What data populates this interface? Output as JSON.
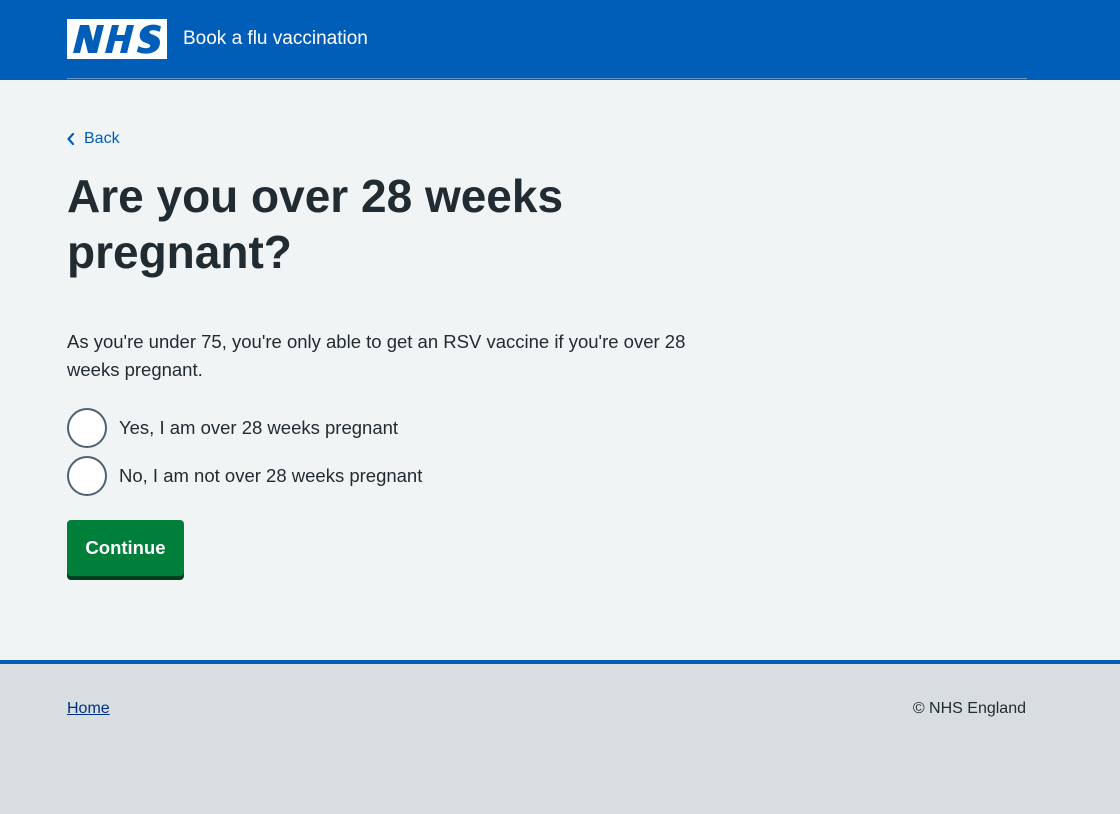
{
  "header": {
    "logo_text": "NHS",
    "service_name": "Book a flu vaccination",
    "brand_color": "#005eb8"
  },
  "back_link": {
    "label": "Back",
    "icon": "chevron-left-icon"
  },
  "question": {
    "heading": "Are you over 28 weeks pregnant?",
    "hint": "As you're under 75, you're only able to get an RSV vaccine if you're over 28 weeks pregnant.",
    "options": [
      {
        "label": "Yes, I am over 28 weeks pregnant",
        "selected": false
      },
      {
        "label": "No, I am not over 28 weeks pregnant",
        "selected": false
      }
    ]
  },
  "actions": {
    "continue_label": "Continue",
    "button_color": "#007f3b"
  },
  "footer": {
    "home_link": "Home",
    "copyright": "© NHS England"
  }
}
